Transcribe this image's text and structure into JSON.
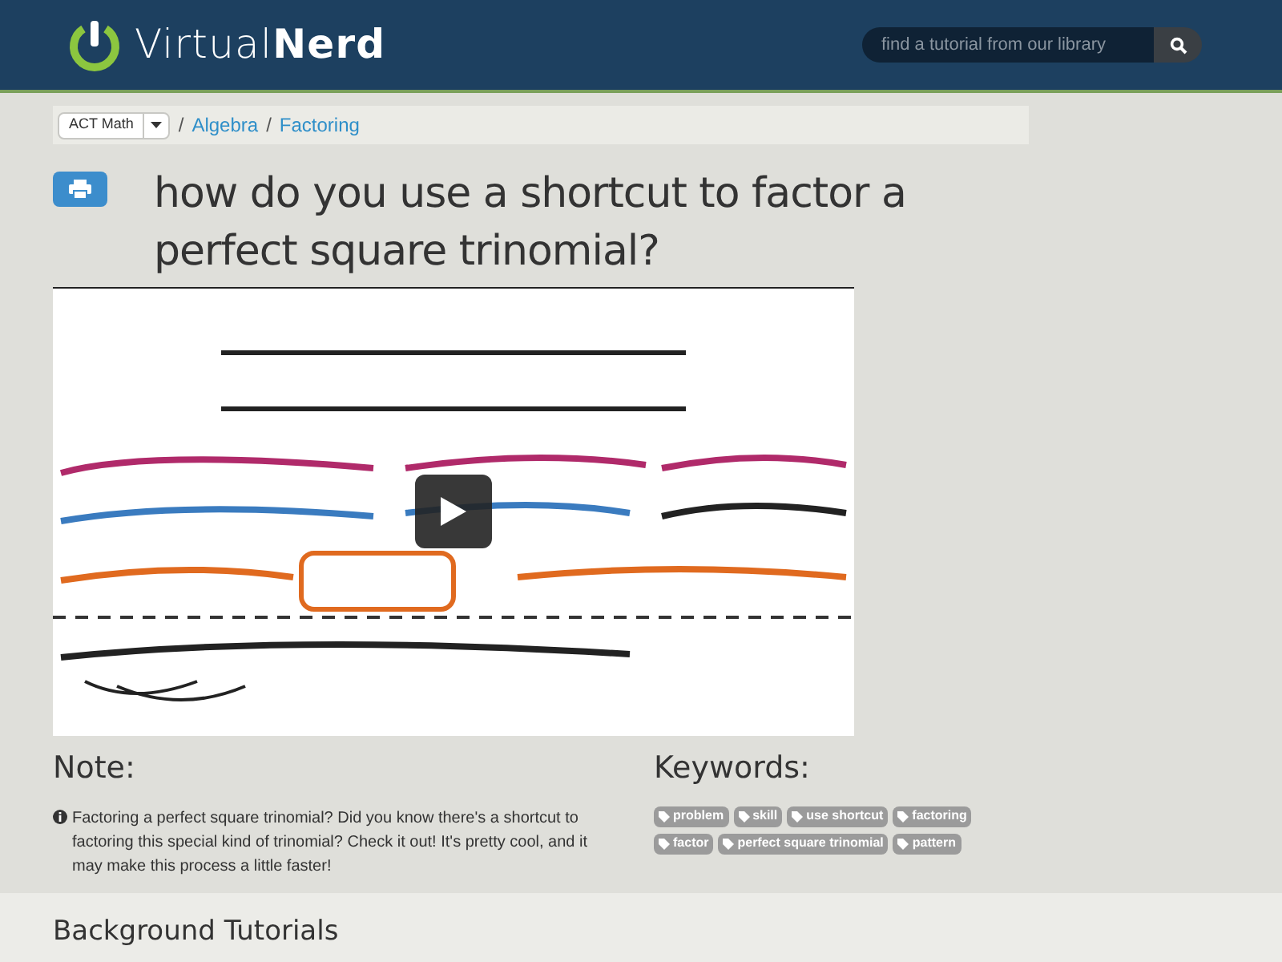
{
  "header": {
    "logo": {
      "light": "Virtual",
      "bold": "Nerd"
    },
    "search": {
      "placeholder": "find a tutorial from our library"
    }
  },
  "breadcrumb": {
    "dropdown": "ACT Math",
    "links": [
      {
        "separator": "/",
        "label": "Algebra"
      },
      {
        "separator": "/",
        "label": "Factoring"
      }
    ]
  },
  "title": "how do you use a shortcut to factor a perfect square trinomial?",
  "note": {
    "heading": "Note:",
    "text": "Factoring a perfect square trinomial? Did you know there's a shortcut to factoring this special kind of trinomial? Check it out! It's pretty cool, and it may make this process a little faster!"
  },
  "keywords": {
    "heading": "Keywords:",
    "tags": [
      "problem",
      "skill",
      "use shortcut",
      "factoring",
      "factor",
      "perfect square trinomial",
      "pattern"
    ]
  },
  "background": {
    "heading": "Background Tutorials"
  }
}
